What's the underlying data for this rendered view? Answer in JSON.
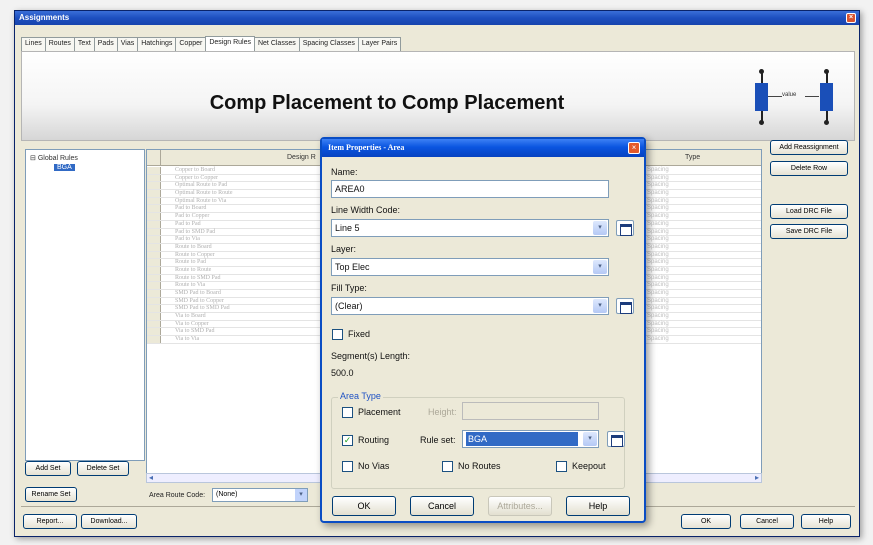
{
  "window": {
    "title": "Assignments"
  },
  "tabs": [
    "Lines",
    "Routes",
    "Text",
    "Pads",
    "Vias",
    "Hatchings",
    "Copper",
    "Design Rules",
    "Net Classes",
    "Spacing Classes",
    "Layer Pairs"
  ],
  "active_tab": "Design Rules",
  "banner": {
    "title": "Comp Placement to Comp Placement",
    "diagram_label": "value"
  },
  "tree": {
    "root": "Global Rules",
    "child": "BGA"
  },
  "grid": {
    "col_design": "Design R",
    "col_type": "Type",
    "rows": [
      {
        "name": "Copper to Board",
        "type": "Spacing"
      },
      {
        "name": "Copper to Copper",
        "type": "Spacing"
      },
      {
        "name": "Optimal Route to Pad",
        "type": "Spacing"
      },
      {
        "name": "Optimal Route to Route",
        "type": "Spacing"
      },
      {
        "name": "Optimal Route to Via",
        "type": "Spacing"
      },
      {
        "name": "Pad to Board",
        "type": "Spacing"
      },
      {
        "name": "Pad to Copper",
        "type": "Spacing"
      },
      {
        "name": "Pad to Pad",
        "type": "Spacing"
      },
      {
        "name": "Pad to SMD Pad",
        "type": "Spacing"
      },
      {
        "name": "Pad to Via",
        "type": "Spacing"
      },
      {
        "name": "Route to Board",
        "type": "Spacing"
      },
      {
        "name": "Route to Copper",
        "type": "Spacing"
      },
      {
        "name": "Route to Pad",
        "type": "Spacing"
      },
      {
        "name": "Route to Route",
        "type": "Spacing"
      },
      {
        "name": "Route to SMD Pad",
        "type": "Spacing"
      },
      {
        "name": "Route to Via",
        "type": "Spacing"
      },
      {
        "name": "SMD Pad to Board",
        "type": "Spacing"
      },
      {
        "name": "SMD Pad to Copper",
        "type": "Spacing"
      },
      {
        "name": "SMD Pad to SMD Pad",
        "type": "Spacing"
      },
      {
        "name": "Via to Board",
        "type": "Spacing"
      },
      {
        "name": "Via to Copper",
        "type": "Spacing"
      },
      {
        "name": "Via to SMD Pad",
        "type": "Spacing"
      },
      {
        "name": "Via to Via",
        "type": "Spacing"
      }
    ]
  },
  "right_buttons": {
    "add_reassignment": "Add Reassignment",
    "delete_row": "Delete Row",
    "load_drc": "Load DRC File",
    "save_drc": "Save DRC File"
  },
  "left_buttons": {
    "add_set": "Add Set",
    "delete_set": "Delete Set",
    "rename_set": "Rename Set"
  },
  "route_code": {
    "label": "Area Route Code:",
    "value": "(None)"
  },
  "footer": {
    "report": "Report...",
    "download": "Download...",
    "ok": "OK",
    "cancel": "Cancel",
    "help": "Help"
  },
  "dialog": {
    "title": "Item Properties - Area",
    "name_label": "Name:",
    "name_value": "AREA0",
    "line_width_label": "Line Width Code:",
    "line_width_value": "Line 5",
    "layer_label": "Layer:",
    "layer_value": "Top Elec",
    "fill_type_label": "Fill Type:",
    "fill_type_value": "(Clear)",
    "fixed_label": "Fixed",
    "segment_length_label": "Segment(s) Length:",
    "segment_length_value": "500.0",
    "area_type_label": "Area Type",
    "placement_label": "Placement",
    "height_label": "Height:",
    "routing_label": "Routing",
    "rule_set_label": "Rule set:",
    "rule_set_value": "BGA",
    "no_vias_label": "No Vias",
    "no_routes_label": "No Routes",
    "keepout_label": "Keepout",
    "ok": "OK",
    "cancel": "Cancel",
    "attributes": "Attributes...",
    "help": "Help",
    "checks": {
      "fixed": false,
      "placement": false,
      "routing": true,
      "no_vias": false,
      "no_routes": false,
      "keepout": false
    }
  },
  "colors": {
    "title_blue": "#0a55e0",
    "selection": "#316ac5",
    "banner_component": "#1a4fb8"
  }
}
